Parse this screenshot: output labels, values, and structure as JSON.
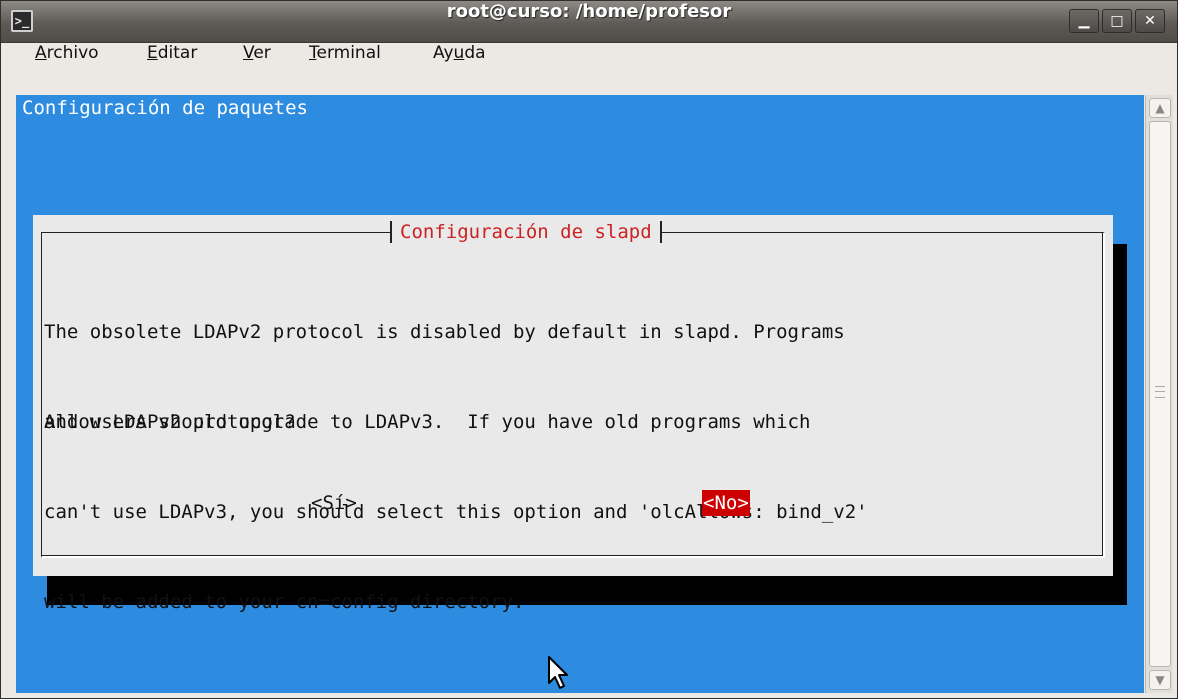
{
  "window": {
    "title": "root@curso: /home/profesor",
    "icon": "terminal-icon",
    "controls": {
      "minimize": "▁",
      "maximize": "□",
      "close": "✕"
    }
  },
  "menubar": {
    "items": [
      {
        "pre": "",
        "u": "A",
        "post": "rchivo"
      },
      {
        "pre": "",
        "u": "E",
        "post": "ditar"
      },
      {
        "pre": "",
        "u": "V",
        "post": "er"
      },
      {
        "pre": "",
        "u": "T",
        "post": "erminal"
      },
      {
        "pre": "Ay",
        "u": "u",
        "post": "da"
      }
    ]
  },
  "terminal": {
    "header": "Configuración de paquetes",
    "dialog": {
      "title": "Configuración de slapd",
      "message_lines": [
        "The obsolete LDAPv2 protocol is disabled by default in slapd. Programs",
        "and users should upgrade to LDAPv3.  If you have old programs which",
        "can't use LDAPv3, you should select this option and 'olcAllows: bind_v2'",
        "will be added to your cn=config directory."
      ],
      "question": "Allow LDAPv2 protocol?",
      "buttons": {
        "yes": "<Sí>",
        "no": "<No>"
      }
    }
  },
  "colors": {
    "terminal_bg": "#2d8be0",
    "dialog_bg": "#e9e9e9",
    "dialog_title": "#cc2222",
    "selected_button_bg": "#cc0000"
  },
  "scrollbar": {
    "up_arrow": "▲",
    "down_arrow": "▼"
  }
}
